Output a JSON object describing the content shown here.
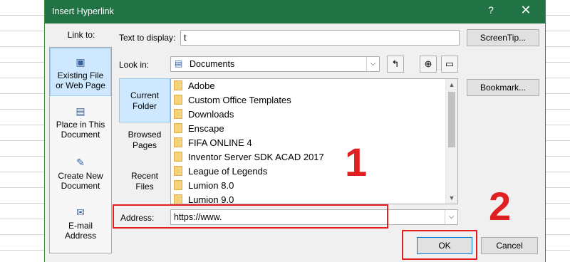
{
  "dialog": {
    "title": "Insert Hyperlink",
    "help_glyph": "?",
    "close_glyph": "✕"
  },
  "link_to": {
    "label": "Link to:",
    "items": [
      {
        "label_line1": "Existing File",
        "label_line2": "or Web Page",
        "icon": "web-page-icon",
        "glyph": "▣"
      },
      {
        "label_line1": "Place in This",
        "label_line2": "Document",
        "icon": "document-place-icon",
        "glyph": "▤"
      },
      {
        "label_line1": "Create New",
        "label_line2": "Document",
        "icon": "new-document-icon",
        "glyph": "✎"
      },
      {
        "label_line1": "E-mail",
        "label_line2": "Address",
        "icon": "email-icon",
        "glyph": "✉"
      }
    ]
  },
  "text_to_display": {
    "label": "Text to display:",
    "value": "t"
  },
  "screentip_button": "ScreenTip...",
  "look_in": {
    "label": "Look in:",
    "value": "Documents",
    "icon_glyph": "▤",
    "tool_glyphs": {
      "up": "↰",
      "browse_web": "⊕",
      "browse_file": "▭"
    }
  },
  "bookmark_button": "Bookmark...",
  "side_tabs": [
    {
      "line1": "Current",
      "line2": "Folder"
    },
    {
      "line1": "Browsed",
      "line2": "Pages"
    },
    {
      "line1": "Recent",
      "line2": "Files"
    }
  ],
  "files": [
    "Adobe",
    "Custom Office Templates",
    "Downloads",
    "Enscape",
    "FIFA ONLINE 4",
    "Inventor Server SDK ACAD 2017",
    "League of Legends",
    "Lumion 8.0",
    "Lumion 9.0"
  ],
  "scroll_glyphs": {
    "up": "▲",
    "down": "▼",
    "combo": "⌵"
  },
  "address": {
    "label": "Address:",
    "value": "https://www."
  },
  "ok_button": "OK",
  "cancel_button": "Cancel",
  "annotations": {
    "step1": "1",
    "step2": "2"
  },
  "colors": {
    "titlebar": "#217346",
    "annotation": "#e02020",
    "selection": "#cde8ff"
  }
}
